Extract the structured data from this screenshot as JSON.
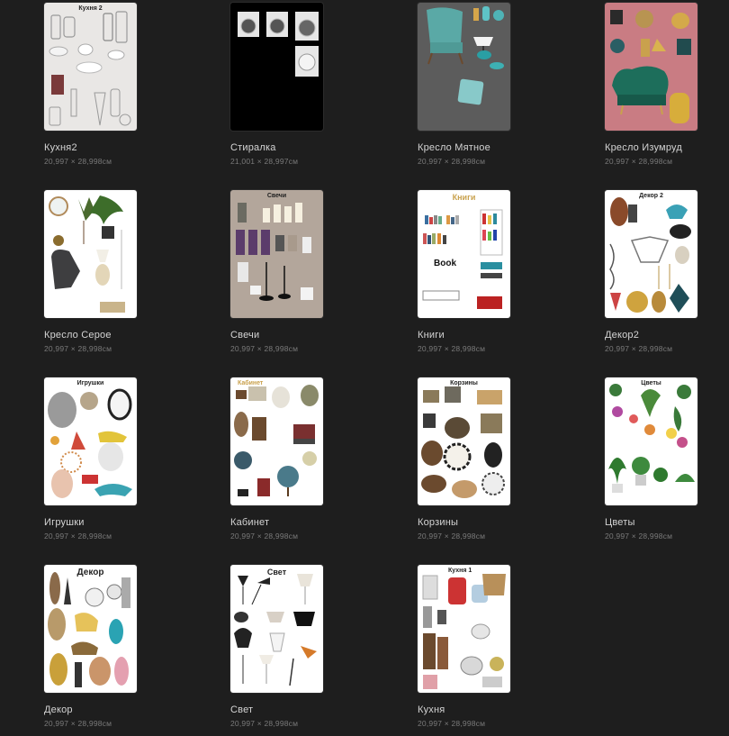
{
  "documents": [
    {
      "id": "kitchen2",
      "name": "Кухня2",
      "size": "20,997 × 28,998см",
      "thumb_title": "Кухня 2",
      "bg": "#e9e7e5",
      "title_dark": false
    },
    {
      "id": "washer",
      "name": "Стиралка",
      "size": "21,001 × 28,997см",
      "thumb_title": "",
      "bg": "#000000",
      "title_dark": false
    },
    {
      "id": "chair-mint",
      "name": "Кресло Мятное",
      "size": "20,997 × 28,998см",
      "thumb_title": "",
      "bg": "#5c5c5c",
      "title_dark": false
    },
    {
      "id": "chair-emerald",
      "name": "Кресло Изумруд",
      "size": "20,997 × 28,998см",
      "thumb_title": "",
      "bg": "#c97c83",
      "title_dark": false
    },
    {
      "id": "chair-grey",
      "name": "Кресло Серое",
      "size": "20,997 × 28,998см",
      "thumb_title": "",
      "bg": "#ffffff",
      "title_dark": false
    },
    {
      "id": "candles",
      "name": "Свечи",
      "size": "20,997 × 28,998см",
      "thumb_title": "Свечи",
      "bg": "#b3a69b",
      "title_dark": false
    },
    {
      "id": "books",
      "name": "Книги",
      "size": "20,997 × 28,998см",
      "thumb_title": "Книги",
      "bg": "#ffffff",
      "title_dark": false
    },
    {
      "id": "decor2",
      "name": "Декор2",
      "size": "20,997 × 28,998см",
      "thumb_title": "Декор 2",
      "bg": "#ffffff",
      "title_dark": false
    },
    {
      "id": "toys",
      "name": "Игрушки",
      "size": "20,997 × 28,998см",
      "thumb_title": "Игрушки",
      "bg": "#ffffff",
      "title_dark": false
    },
    {
      "id": "cabinet",
      "name": "Кабинет",
      "size": "20,997 × 28,998см",
      "thumb_title": "Кабинет",
      "bg": "#ffffff",
      "title_dark": false
    },
    {
      "id": "baskets",
      "name": "Корзины",
      "size": "20,997 × 28,998см",
      "thumb_title": "Корзины",
      "bg": "#ffffff",
      "title_dark": false
    },
    {
      "id": "flowers",
      "name": "Цветы",
      "size": "20,997 × 28,998см",
      "thumb_title": "Цветы",
      "bg": "#ffffff",
      "title_dark": false
    },
    {
      "id": "decor",
      "name": "Декор",
      "size": "20,997 × 28,998см",
      "thumb_title": "Декор",
      "bg": "#ffffff",
      "title_dark": false
    },
    {
      "id": "light",
      "name": "Свет",
      "size": "20,997 × 28,998см",
      "thumb_title": "Свет",
      "bg": "#ffffff",
      "title_dark": false
    },
    {
      "id": "kitchen",
      "name": "Кухня",
      "size": "20,997 × 28,998см",
      "thumb_title": "Кухня 1",
      "bg": "#ffffff",
      "title_dark": false
    }
  ]
}
